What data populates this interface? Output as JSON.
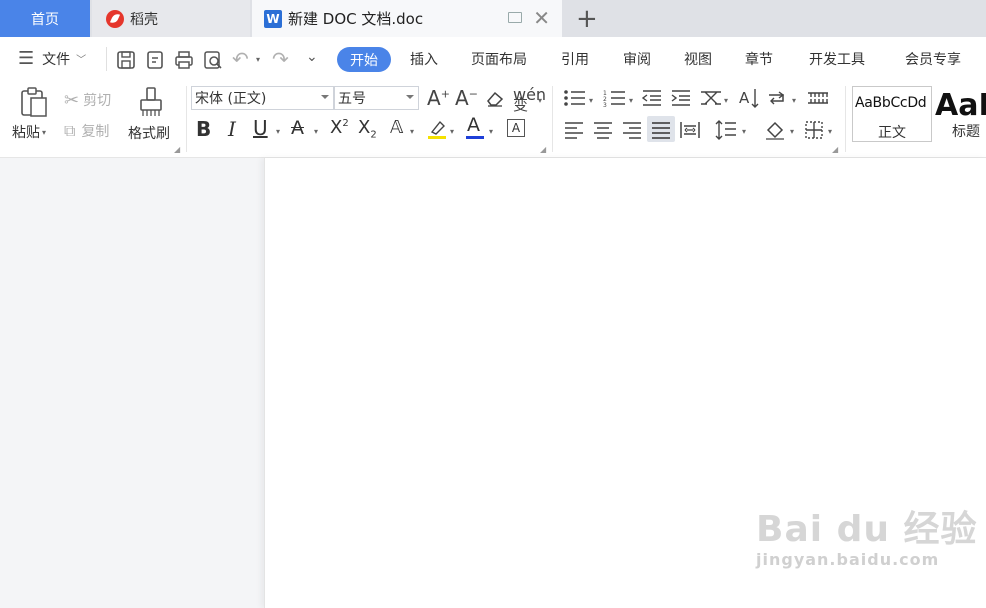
{
  "tabs": {
    "home": "首页",
    "daoke": "稻壳",
    "doc": "新建 DOC 文档.doc",
    "doc_logo": "W"
  },
  "menu": {
    "file": "文件",
    "start": "开始",
    "insert": "插入",
    "layout": "页面布局",
    "reference": "引用",
    "review": "审阅",
    "view": "视图",
    "chapter": "章节",
    "devtools": "开发工具",
    "member": "会员专享"
  },
  "ribbon": {
    "paste": "粘贴",
    "cut": "剪切",
    "copy": "复制",
    "format_painter": "格式刷",
    "font_name": "宋体 (正文)",
    "font_size": "五号",
    "bold": "B",
    "italic": "I",
    "underline": "U",
    "styles": {
      "normal_preview": "AaBbCcDd",
      "normal_label": "正文",
      "heading_preview": "AaB",
      "heading_label": "标题"
    }
  },
  "watermark": {
    "main": "Bai du 经验",
    "sub": "jingyan.baidu.com"
  },
  "colors": {
    "accent": "#4a84e8",
    "highlight": "#f5e100",
    "font_color": "#1e3fd8"
  }
}
